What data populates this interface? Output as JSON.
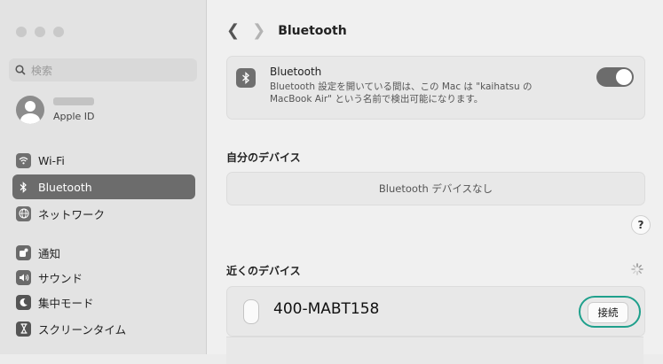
{
  "sidebar": {
    "search_placeholder": "検索",
    "account": {
      "label": "Apple ID"
    },
    "items": [
      {
        "label": "Wi-Fi",
        "icon": "wifi-icon",
        "active": false
      },
      {
        "label": "Bluetooth",
        "icon": "bluetooth-icon",
        "active": true
      },
      {
        "label": "ネットワーク",
        "icon": "globe-icon",
        "active": false
      },
      {
        "label": "通知",
        "icon": "notification-icon",
        "active": false
      },
      {
        "label": "サウンド",
        "icon": "speaker-icon",
        "active": false
      },
      {
        "label": "集中モード",
        "icon": "moon-icon",
        "active": false
      },
      {
        "label": "スクリーンタイム",
        "icon": "hourglass-icon",
        "active": false
      }
    ]
  },
  "header": {
    "title": "Bluetooth"
  },
  "bluetooth_card": {
    "title": "Bluetooth",
    "description": "Bluetooth 設定を開いている間は、この Mac は \"kaihatsu の MacBook Air\" という名前で検出可能になります。",
    "toggle_on": true
  },
  "my_devices": {
    "title": "自分のデバイス",
    "empty_text": "Bluetooth デバイスなし"
  },
  "help": {
    "label": "?"
  },
  "nearby_devices": {
    "title": "近くのデバイス",
    "devices": [
      {
        "name": "400-MABT158",
        "action_label": "接続"
      }
    ]
  },
  "colors": {
    "highlight_ring": "#1fa08c",
    "active_item": "#6c6c6c"
  }
}
